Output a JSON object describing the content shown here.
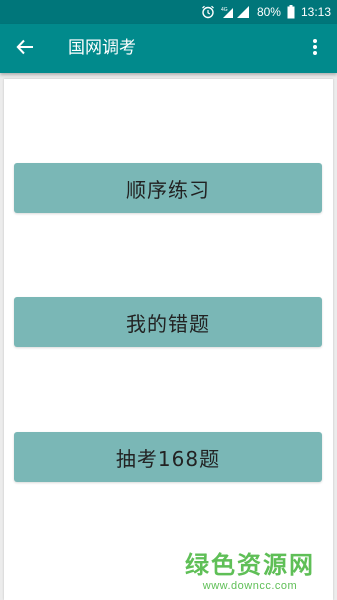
{
  "status_bar": {
    "battery": "80%",
    "time": "13:13",
    "icons": [
      "alarm-icon",
      "signal-icon",
      "battery-icon"
    ]
  },
  "app_bar": {
    "title": "国网调考",
    "back_icon": "back-arrow-icon",
    "menu_icon": "overflow-menu-icon"
  },
  "menu": {
    "items": [
      {
        "label": "顺序练习"
      },
      {
        "label": "我的错题"
      },
      {
        "label": "抽考168题"
      }
    ]
  },
  "watermark": {
    "title": "绿色资源网",
    "url": "www.downcc.com"
  },
  "colors": {
    "status_bar": "#00767a",
    "app_bar": "#018a8c",
    "button": "#7ab7b6",
    "watermark": "#5fbf57"
  }
}
